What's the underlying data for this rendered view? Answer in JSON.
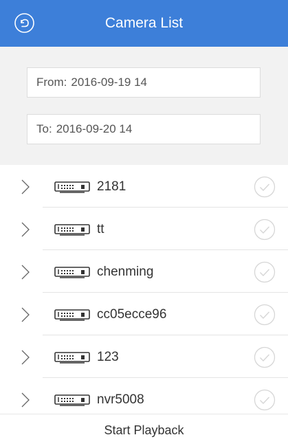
{
  "header": {
    "title": "Camera List",
    "back_icon": "back-arrow-circle-icon",
    "background": "#3d7fd9"
  },
  "filter": {
    "from_label": "From:",
    "from_value": "2016-09-19 14",
    "to_label": "To:",
    "to_value": "2016-09-20 14"
  },
  "cameras": [
    {
      "name": "2181",
      "expand_icon": "chevron-right-icon",
      "device_icon": "nvr-device-icon",
      "check_icon": "check-circle-icon"
    },
    {
      "name": "tt",
      "expand_icon": "chevron-right-icon",
      "device_icon": "nvr-device-icon",
      "check_icon": "check-circle-icon"
    },
    {
      "name": "chenming",
      "expand_icon": "chevron-right-icon",
      "device_icon": "nvr-device-icon",
      "check_icon": "check-circle-icon"
    },
    {
      "name": "cc05ecce96",
      "expand_icon": "chevron-right-icon",
      "device_icon": "nvr-device-icon",
      "check_icon": "check-circle-icon"
    },
    {
      "name": "123",
      "expand_icon": "chevron-right-icon",
      "device_icon": "nvr-device-icon",
      "check_icon": "check-circle-icon"
    },
    {
      "name": "nvr5008",
      "expand_icon": "chevron-right-icon",
      "device_icon": "nvr-device-icon",
      "check_icon": "check-circle-icon"
    }
  ],
  "footer": {
    "start_label": "Start Playback"
  }
}
